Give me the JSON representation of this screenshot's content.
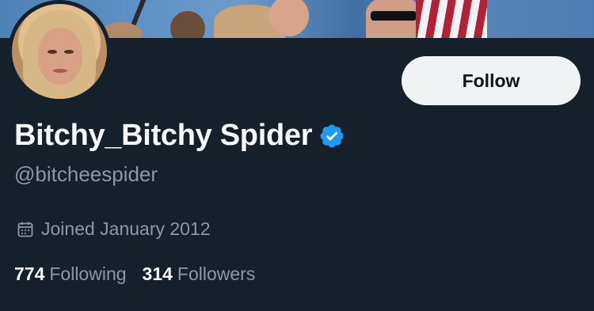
{
  "profile": {
    "display_name": "Bitchy_Bitchy Spider",
    "handle": "@bitcheespider",
    "joined": "Joined January 2012",
    "verified": true
  },
  "actions": {
    "follow_label": "Follow"
  },
  "stats": {
    "following_count": "774",
    "following_label": "Following",
    "followers_count": "314",
    "followers_label": "Followers"
  },
  "colors": {
    "background": "#15202b",
    "verified_badge": "#1d9bf0",
    "secondary_text": "#8b98a5",
    "button_bg": "#eff3f4"
  }
}
